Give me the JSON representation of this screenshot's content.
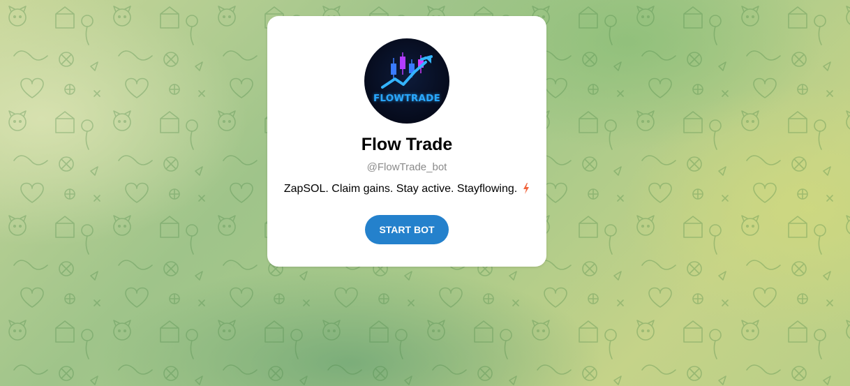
{
  "bot": {
    "avatar_text": "FLOWTRADE",
    "name": "Flow Trade",
    "username": "@FlowTrade_bot",
    "description": "ZapSOL. Claim gains. Stay active. Stayflowing.",
    "description_icon": "lightning-bolt-icon"
  },
  "actions": {
    "start_label": "START BOT"
  },
  "colors": {
    "button": "#2481cc",
    "card": "#ffffff",
    "background": "#a8c98a",
    "bolt": "#f0643c"
  }
}
